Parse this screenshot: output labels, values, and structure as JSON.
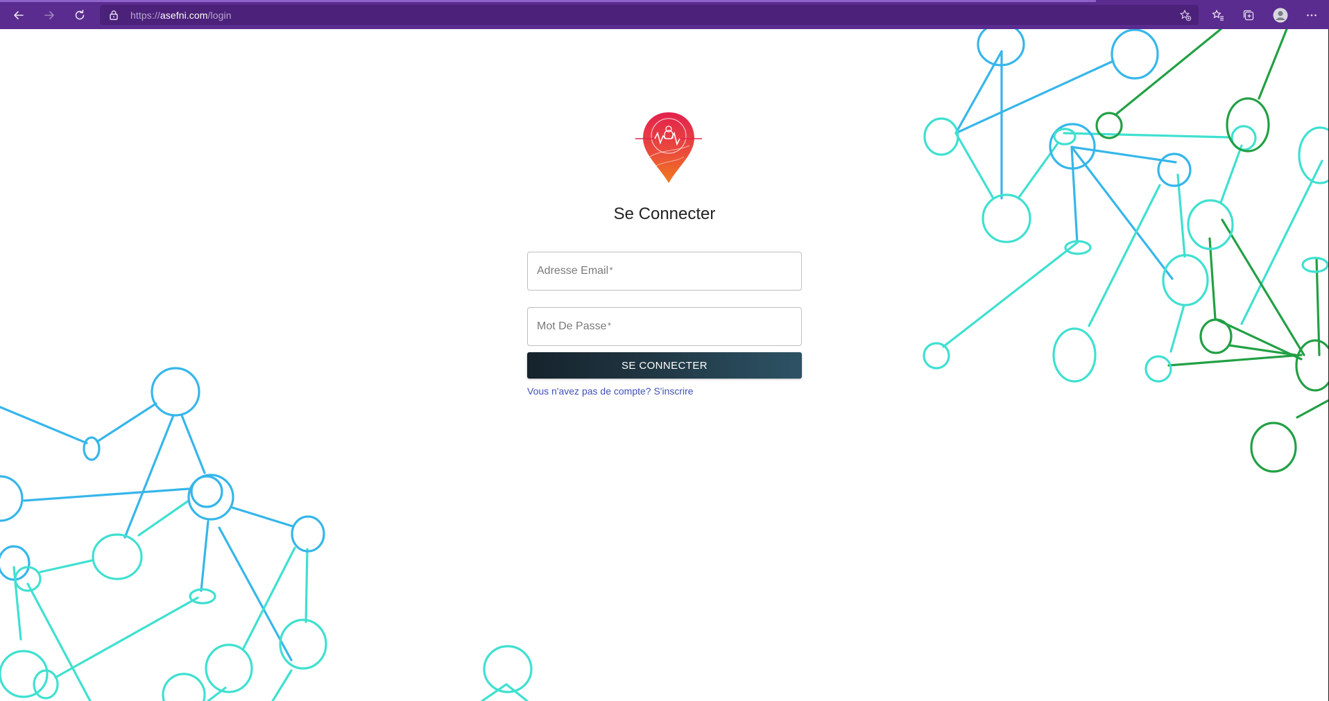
{
  "browser": {
    "url_scheme": "https://",
    "url_host": "asefni.com",
    "url_path": "/login"
  },
  "login": {
    "title": "Se Connecter",
    "email_label": "Adresse Email",
    "password_label": "Mot De Passe",
    "required_mark": "*",
    "submit_label": "SE CONNECTER",
    "signup_link": "Vous n'avez pas de compte? S'inscrire"
  },
  "theme": {
    "toolbar_color": "#5b2c8f",
    "button_gradient_start": "#15232c",
    "button_gradient_end": "#2d5365",
    "link_color": "#3f51b5",
    "network_blue": "#2e9be6",
    "network_cyan": "#3fe0d0",
    "network_green": "#22a045"
  }
}
